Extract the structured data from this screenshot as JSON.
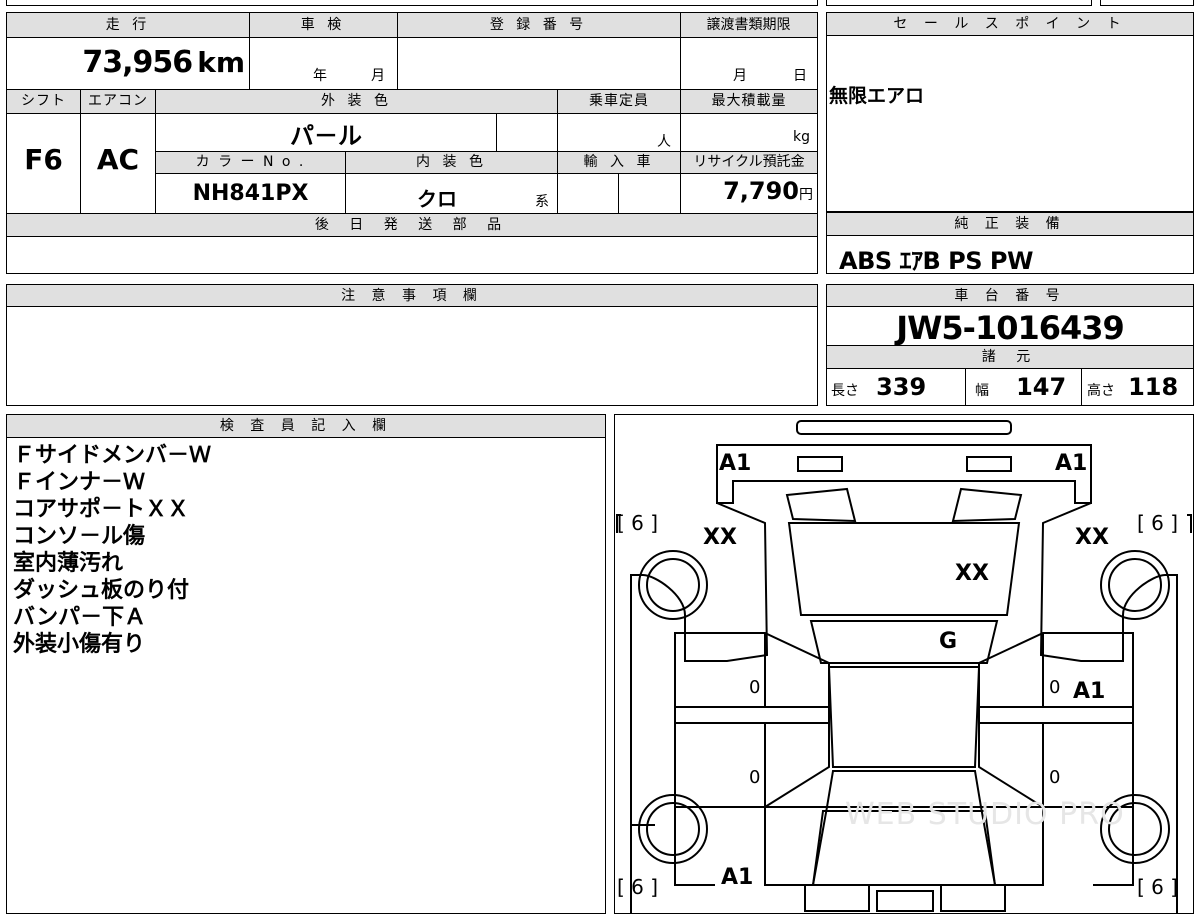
{
  "grid": {
    "mileage_label": "走 行",
    "mileage_value": "73,956",
    "mileage_unit": "km",
    "inspection_label": "車 検",
    "inspection_year": "年",
    "inspection_month": "月",
    "registration_label": "登 録 番 号",
    "transfer_label": "譲渡書類期限",
    "transfer_month": "月",
    "transfer_day": "日",
    "shift_label": "シフト",
    "shift_value": "F6",
    "ac_label": "エアコン",
    "ac_value": "AC",
    "ext_color_label": "外 装 色",
    "ext_color_value": "パ－ル",
    "capacity_label": "乗車定員",
    "capacity_unit": "人",
    "max_load_label": "最大積載量",
    "max_load_unit": "kg",
    "color_no_label": "カ ラ ー N o .",
    "color_no_value": "NH841PX",
    "int_color_label": "内 装 色",
    "int_color_value": "クロ",
    "int_color_suffix": "系",
    "import_label": "輸 入 車",
    "recycle_label": "リサイクル預託金",
    "recycle_value": "7,790",
    "recycle_unit": "円",
    "later_parts_label": "後 日 発 送 部 品"
  },
  "sales_point": {
    "label": "セ ー ル ス ポ イ ン ト",
    "text": "無限エアロ"
  },
  "equipment": {
    "label": "純 正 装 備",
    "text": "ABS ｴｱB PS PW"
  },
  "caution": {
    "label": "注 意 事 項 欄"
  },
  "chassis": {
    "label": "車 台 番 号",
    "value": "JW5-1016439",
    "spec_label": "諸 元",
    "length_label": "長さ",
    "length_value": "339",
    "width_label": "幅",
    "width_value": "147",
    "height_label": "高さ",
    "height_value": "118"
  },
  "inspector": {
    "label": "検 査 員 記 入 欄",
    "lines": [
      "Ｆサイドメンバ－Ｗ",
      "Ｆインナ－Ｗ",
      "コアサポ－トＸＸ",
      "コンソ－ル傷",
      "室内薄汚れ",
      "ダッシュ板のり付",
      "バンパ－下Ａ",
      "外装小傷有り"
    ]
  },
  "diagram": {
    "labels": {
      "front_left": "A1",
      "front_right": "A1",
      "tire_fl": "[ 6 ]",
      "tire_fr": "[ 6 ]",
      "fender_fl": "XX",
      "fender_fr": "XX",
      "hood": "XX",
      "windshield": "G",
      "door_fl": "0",
      "door_fr": "0",
      "door_fr_mark": "A1",
      "door_rl": "0",
      "door_rr": "0",
      "rear": "A1",
      "tire_rl": "[ 6 ]",
      "tire_rr": "[ 6 ]"
    },
    "watermark": "WEB STUDIO PRO"
  }
}
